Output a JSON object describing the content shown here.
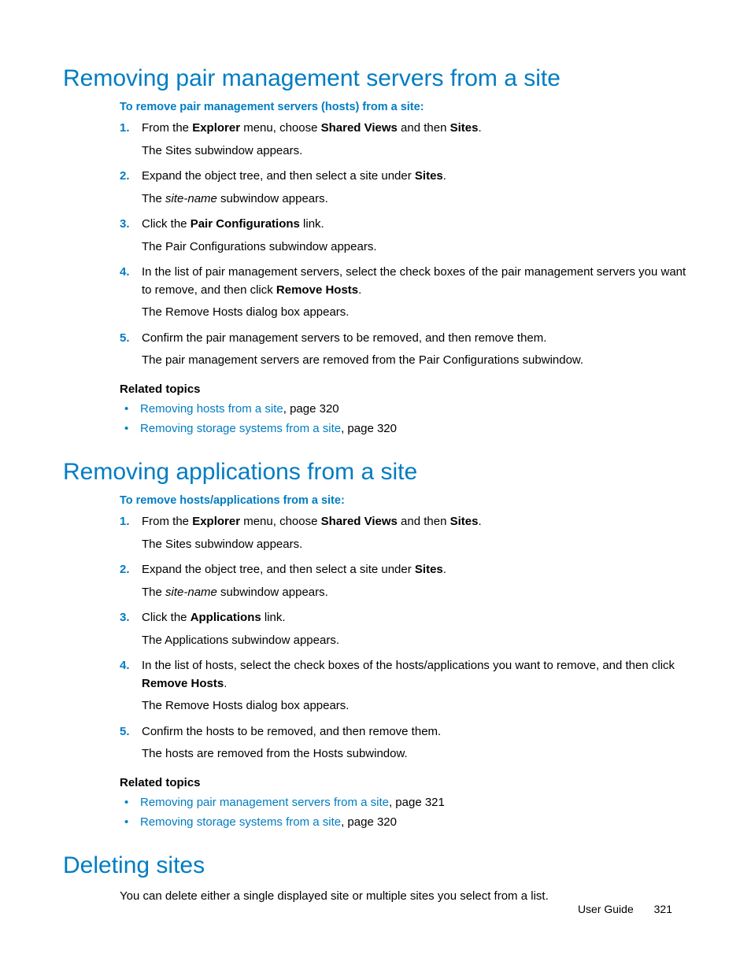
{
  "section1": {
    "title": "Removing pair management servers from a site",
    "intro": "To remove pair management servers (hosts) from a site:",
    "steps": {
      "s1a1": "From the ",
      "s1a2": "Explorer",
      "s1a3": " menu, choose ",
      "s1a4": "Shared Views",
      "s1a5": " and then ",
      "s1a6": "Sites",
      "s1a7": ".",
      "s1n": "The Sites subwindow appears.",
      "s2a1": "Expand the object tree, and then select a site under ",
      "s2a2": "Sites",
      "s2a3": ".",
      "s2n1": "The ",
      "s2n2": "site-name",
      "s2n3": " subwindow appears.",
      "s3a1": "Click the ",
      "s3a2": "Pair Configurations",
      "s3a3": " link.",
      "s3n": "The Pair Configurations subwindow appears.",
      "s4a1": "In the list of pair management servers, select the check boxes of the pair management servers you want to remove, and then click ",
      "s4a2": "Remove Hosts",
      "s4a3": ".",
      "s4n": "The Remove Hosts dialog box appears.",
      "s5a": "Confirm the pair management servers to be removed, and then remove them.",
      "s5n": "The pair management servers are removed from the Pair Configurations subwindow."
    },
    "related_heading": "Related topics",
    "related": {
      "r1link": "Removing hosts from a site",
      "r1tail": ", page 320",
      "r2link": "Removing storage systems from a site",
      "r2tail": ", page 320"
    }
  },
  "section2": {
    "title": "Removing applications from a site",
    "intro": "To remove hosts/applications from a site:",
    "steps": {
      "s1a1": "From the ",
      "s1a2": "Explorer",
      "s1a3": " menu, choose ",
      "s1a4": "Shared Views",
      "s1a5": " and then ",
      "s1a6": "Sites",
      "s1a7": ".",
      "s1n": "The Sites subwindow appears.",
      "s2a1": "Expand the object tree, and then select a site under ",
      "s2a2": "Sites",
      "s2a3": ".",
      "s2n1": "The ",
      "s2n2": "site-name",
      "s2n3": " subwindow appears.",
      "s3a1": "Click the ",
      "s3a2": "Applications",
      "s3a3": " link.",
      "s3n": "The Applications subwindow appears.",
      "s4a1": "In the list of hosts, select the check boxes of the hosts/applications you want to remove, and then click ",
      "s4a2": "Remove Hosts",
      "s4a3": ".",
      "s4n": "The Remove Hosts dialog box appears.",
      "s5a": "Confirm the hosts to be removed, and then remove them.",
      "s5n": "The hosts are removed from the Hosts subwindow."
    },
    "related_heading": "Related topics",
    "related": {
      "r1link": "Removing pair management servers from a site",
      "r1tail": ", page 321",
      "r2link": "Removing storage systems from a site",
      "r2tail": ", page 320"
    }
  },
  "section3": {
    "title": "Deleting sites",
    "body": "You can delete either a single displayed site or multiple sites you select from a list."
  },
  "footer": {
    "label": "User Guide",
    "page": "321"
  }
}
